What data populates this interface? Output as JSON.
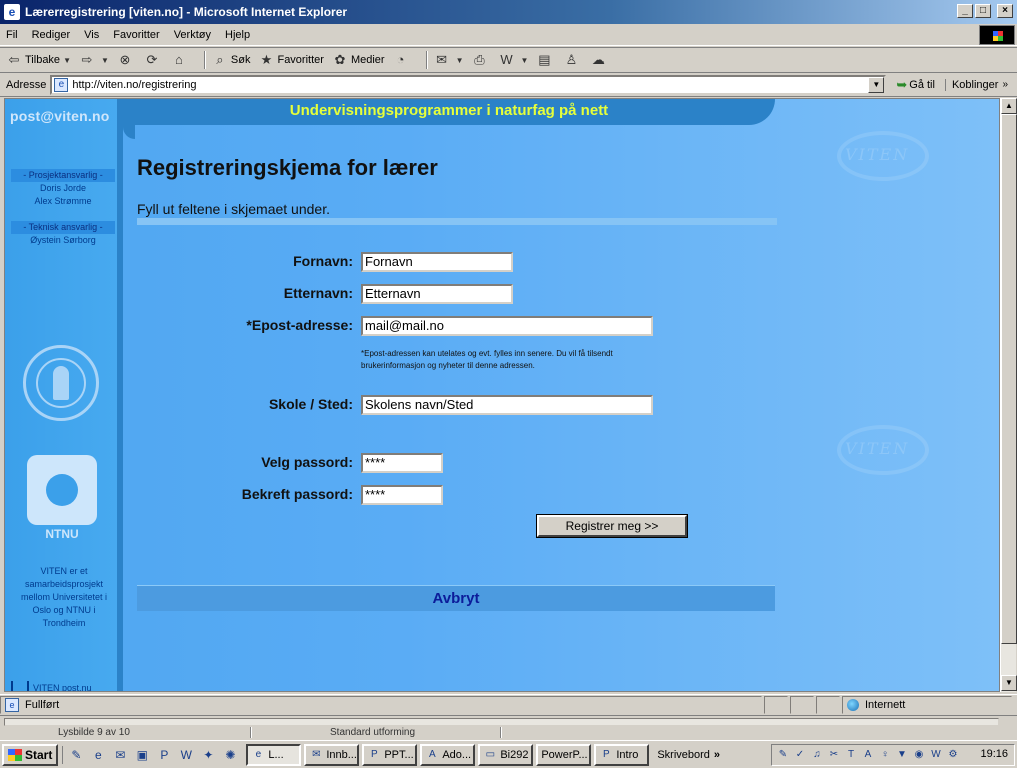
{
  "window": {
    "title": "Lærerregistrering [viten.no] - Microsoft Internet Explorer",
    "min_glyph": "_",
    "max_glyph": "□",
    "close_glyph": "×"
  },
  "menu": [
    "Fil",
    "Rediger",
    "Vis",
    "Favoritter",
    "Verktøy",
    "Hjelp"
  ],
  "toolbar": {
    "back": "Tilbake",
    "search": "Søk",
    "favorites": "Favoritter",
    "media": "Medier"
  },
  "address": {
    "label": "Adresse",
    "url": "http://viten.no/registrering",
    "go": "Gå til",
    "links": "Koblinger"
  },
  "site": {
    "logo_text": "post@viten.no",
    "banner": "Undervisningsprogrammer i naturfag på nett",
    "nav": [
      {
        "role": "- Prosjektansvarlig -",
        "names": [
          "Doris Jorde",
          "Alex Strømme"
        ]
      },
      {
        "role": "- Teknisk ansvarlig -",
        "names": [
          "Øystein Sørborg"
        ]
      }
    ],
    "ntnu_label": "NTNU",
    "collab_text": "VITEN er et samarbeidsprosjekt mellom Universitetet i Oslo og NTNU i Trondheim",
    "footer_link": "VITEN post.nu",
    "watermark": "VITEN"
  },
  "form": {
    "title": "Registreringskjema for lærer",
    "subtitle": "Fyll ut feltene i skjemaet under.",
    "fields": {
      "first_name": {
        "label": "Fornavn:",
        "value": "Fornavn"
      },
      "last_name": {
        "label": "Etternavn:",
        "value": "Etternavn"
      },
      "email": {
        "label": "*Epost-adresse:",
        "value": "mail@mail.no"
      },
      "school": {
        "label": "Skole / Sted:",
        "value": "Skolens navn/Sted"
      },
      "password": {
        "label": "Velg passord:",
        "value": "****"
      },
      "confirm_password": {
        "label": "Bekreft passord:",
        "value": "****"
      }
    },
    "email_note": "*Epost-adressen kan utelates og evt. fylles inn senere. Du vil få tilsendt brukerinformasjon og nyheter til denne adressen.",
    "submit": "Registrer meg >>",
    "cancel": "Avbryt"
  },
  "status": {
    "text": "Fullført",
    "zone": "Internett"
  },
  "background_window": {
    "slide": "Lysbilde 9 av 10",
    "design": "Standard utforming"
  },
  "taskbar": {
    "start": "Start",
    "tasks": [
      "L...",
      "Innb...",
      "PPT...",
      "Ado...",
      "Bi292",
      "PowerP...",
      "Intro"
    ],
    "desktop": "Skrivebord",
    "clock": "19:16"
  },
  "icons": {
    "back": "back-arrow-icon",
    "forward": "forward-arrow-icon",
    "stop": "stop-icon",
    "refresh": "refresh-icon",
    "home": "home-icon",
    "search": "search-icon",
    "favorites": "favorites-icon",
    "media": "media-icon",
    "history": "history-icon",
    "mail": "mail-icon",
    "print": "print-icon",
    "edit": "word-edit-icon",
    "discuss": "discuss-icon",
    "messenger": "messenger-icon",
    "research": "research-icon"
  },
  "colors": {
    "banner_text": "#e6ff3a",
    "cancel_text": "#0c1c9a",
    "page_bg": "#5aacf5"
  }
}
